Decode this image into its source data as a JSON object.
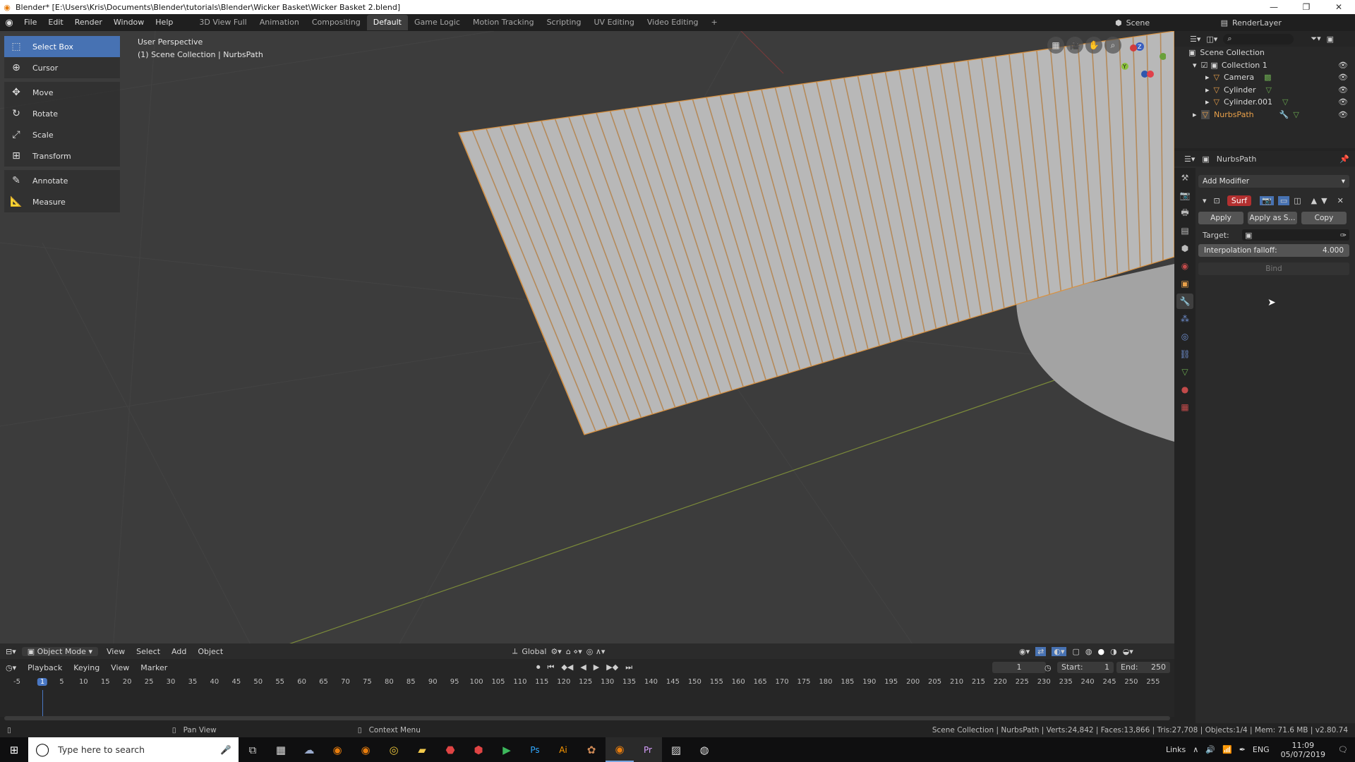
{
  "window": {
    "title": "Blender* [E:\\Users\\Kris\\Documents\\Blender\\tutorials\\Blender\\Wicker Basket\\Wicker Basket 2.blend]"
  },
  "menu": [
    "File",
    "Edit",
    "Render",
    "Window",
    "Help"
  ],
  "workspaces": [
    "3D View Full",
    "Animation",
    "Compositing",
    "Default",
    "Game Logic",
    "Motion Tracking",
    "Scripting",
    "UV Editing",
    "Video Editing"
  ],
  "scene": {
    "scene_name": "Scene",
    "render_layer": "RenderLayer"
  },
  "tools": [
    {
      "label": "Select Box",
      "icon": "select-box-icon"
    },
    {
      "label": "Cursor",
      "icon": "cursor-icon"
    },
    {
      "label": "Move",
      "icon": "move-icon"
    },
    {
      "label": "Rotate",
      "icon": "rotate-icon"
    },
    {
      "label": "Scale",
      "icon": "scale-icon"
    },
    {
      "label": "Transform",
      "icon": "transform-icon"
    },
    {
      "label": "Annotate",
      "icon": "annotate-icon"
    },
    {
      "label": "Measure",
      "icon": "measure-icon"
    }
  ],
  "viewport": {
    "perspective": "User Perspective",
    "collection_info": "(1) Scene Collection | NurbsPath",
    "mode": "Object Mode",
    "header_menu": [
      "View",
      "Select",
      "Add",
      "Object"
    ],
    "orientation": "Global"
  },
  "outliner": {
    "root": "Scene Collection",
    "items": [
      {
        "label": "Collection 1",
        "color": "#d8d8d8"
      },
      {
        "label": "Camera",
        "color": "#d8d8d8"
      },
      {
        "label": "Cylinder",
        "color": "#d8d8d8"
      },
      {
        "label": "Cylinder.001",
        "color": "#d8d8d8"
      },
      {
        "label": "NurbsPath",
        "color": "#e9a04a"
      }
    ]
  },
  "properties": {
    "object_name": "NurbsPath",
    "add_modifier": "Add Modifier",
    "modifier_name": "Surf",
    "apply": "Apply",
    "apply_as": "Apply as S...",
    "copy": "Copy",
    "target_label": "Target:",
    "falloff_label": "Interpolation falloff:",
    "falloff_value": "4.000",
    "bind": "Bind"
  },
  "timeline": {
    "menu": [
      "Playback",
      "Keying",
      "View",
      "Marker"
    ],
    "current_frame": "1",
    "start_label": "Start:",
    "start": "1",
    "end_label": "End:",
    "end": "250",
    "ticks": [
      "-5",
      "1",
      "5",
      "10",
      "15",
      "20",
      "25",
      "30",
      "35",
      "40",
      "45",
      "50",
      "55",
      "60",
      "65",
      "70",
      "75",
      "80",
      "85",
      "90",
      "95",
      "100",
      "105",
      "110",
      "115",
      "120",
      "125",
      "130",
      "135",
      "140",
      "145",
      "150",
      "155",
      "160",
      "165",
      "170",
      "175",
      "180",
      "185",
      "190",
      "195",
      "200",
      "205",
      "210",
      "215",
      "220",
      "225",
      "230",
      "235",
      "240",
      "245",
      "250",
      "255"
    ]
  },
  "status": {
    "left": "Pan View",
    "middle": "Context Menu",
    "right": "Scene Collection | NurbsPath | Verts:24,842 | Faces:13,866 | Tris:27,708 | Objects:1/4 | Mem: 71.6 MB | v2.80.74"
  },
  "taskbar": {
    "search_placeholder": "Type here to search",
    "links": "Links",
    "lang": "ENG",
    "time": "11:09",
    "date": "05/07/2019"
  },
  "colors": {
    "accent": "#4772b3",
    "selected_orange": "#e9a04a",
    "modifier_red": "#b33030",
    "viewport_bg": "#3c3c3c"
  }
}
